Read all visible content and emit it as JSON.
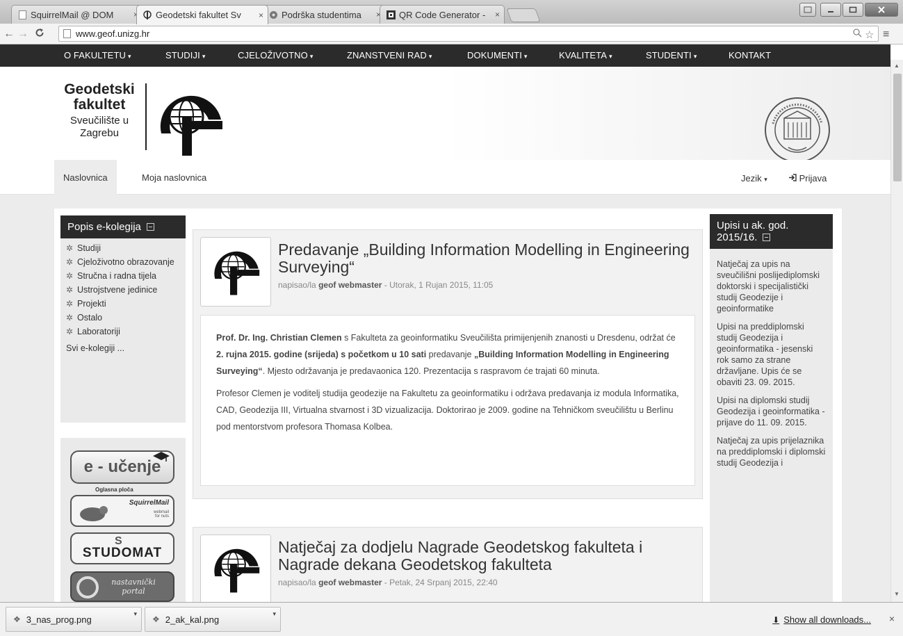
{
  "browser": {
    "tabs": [
      {
        "label": "SquirrelMail @ DOM",
        "icon": "page-icon"
      },
      {
        "label": "Geodetski fakultet Sv",
        "icon": "geof-icon",
        "active": true
      },
      {
        "label": "Podrška studentima",
        "icon": "globe-icon"
      },
      {
        "label": "QR Code Generator -",
        "icon": "qr-icon"
      }
    ],
    "tab_close": "×",
    "url": "www.geof.unizg.hr"
  },
  "site": {
    "topnav": [
      {
        "label": "O FAKULTETU",
        "caret": "▾"
      },
      {
        "label": "STUDIJI",
        "caret": "▾"
      },
      {
        "label": "CJELOŽIVOTNO",
        "caret": "▾"
      },
      {
        "label": "ZNANSTVENI RAD",
        "caret": "▾"
      },
      {
        "label": "DOKUMENTI",
        "caret": "▾"
      },
      {
        "label": "KVALITETA",
        "caret": "▾"
      },
      {
        "label": "STUDENTI",
        "caret": "▾"
      },
      {
        "label": "KONTAKT",
        "caret": ""
      }
    ],
    "logo": {
      "line1": "Geodetski",
      "line2": "fakultet",
      "line3": "Sveučilište u",
      "line4": "Zagrebu"
    },
    "subnav": {
      "home": "Naslovnica",
      "my_home": "Moja naslovnica",
      "language": "Jezik",
      "login": "Prijava"
    },
    "ekolegij": {
      "title": "Popis e-kolegija",
      "items": [
        "Studiji",
        "Cjeloživotno obrazovanje",
        "Stručna i radna tijela",
        "Ustrojstvene jedinice",
        "Projekti",
        "Ostalo",
        "Laboratoriji"
      ],
      "all_link": "Svi e-kolegiji ..."
    },
    "banners": {
      "eucenje": "e - učenje",
      "eucenje_sub": "Oglasna ploča",
      "squirrel": "SquirrelMail",
      "squirrel_sub": "webmail for nuts",
      "studomat": "STUDOMAT",
      "nastavnicki": "nastavnički portal"
    },
    "posts": [
      {
        "title": "Predavanje „Building Information Modelling in Engineering Surveying“",
        "meta_prefix": "napisao/la",
        "author": "geof webmaster",
        "date": "- Utorak, 1 Rujan 2015, 11:05",
        "p1_a": "Prof. Dr. Ing. Christian Clemen",
        "p1_b": " s Fakulteta za geoinformatiku Sveučilišta primijenjenih znanosti u Dresdenu, održat će ",
        "p1_c": "2. rujna 2015. godine (srijeda) s početkom u 10 sati",
        "p1_d": " predavanje ",
        "p1_e": "„Building Information Modelling in Engineering Surveying“",
        "p1_f": ". Mjesto održavanja je predavaonica 120. Prezentacija s raspravom će trajati 60 minuta.",
        "p2": "Profesor Clemen je voditelj studija geodezije na Fakultetu za geoinformatiku i održava predavanja iz modula Informatika, CAD, Geodezija III, Virtualna stvarnost i 3D vizualizacija. Doktorirao je 2009. godine na Tehničkom sveučilištu u Berlinu pod mentorstvom profesora Thomasa Kolbea."
      },
      {
        "title": "Natječaj za dodjelu Nagrade Geodetskog fakulteta i Nagrade dekana Geodetskog fakulteta",
        "meta_prefix": "napisao/la",
        "author": "geof webmaster",
        "date": "- Petak, 24 Srpanj 2015, 22:40"
      }
    ],
    "upisi": {
      "title": "Upisi u ak. god. 2015/16.",
      "items": [
        "Natječaj za upis na sveučilišni poslijediplomski doktorski i specijalistički studij Geodezije i geoinformatike",
        "Upisi na preddiplomski studij Geodezija i geoinformatika - jesenski rok samo za strane državljane. Upis će se obaviti 23. 09. 2015.",
        "Upisi na diplomski studij Geodezija i geoinformatika - prijave do 11. 09. 2015.",
        "Natječaj za upis prijelaznika na preddiplomski i diplomski studij Geodezija i"
      ]
    }
  },
  "downloads": {
    "items": [
      "3_nas_prog.png",
      "2_ak_kal.png"
    ],
    "show_all": "Show all downloads...",
    "close": "×"
  }
}
